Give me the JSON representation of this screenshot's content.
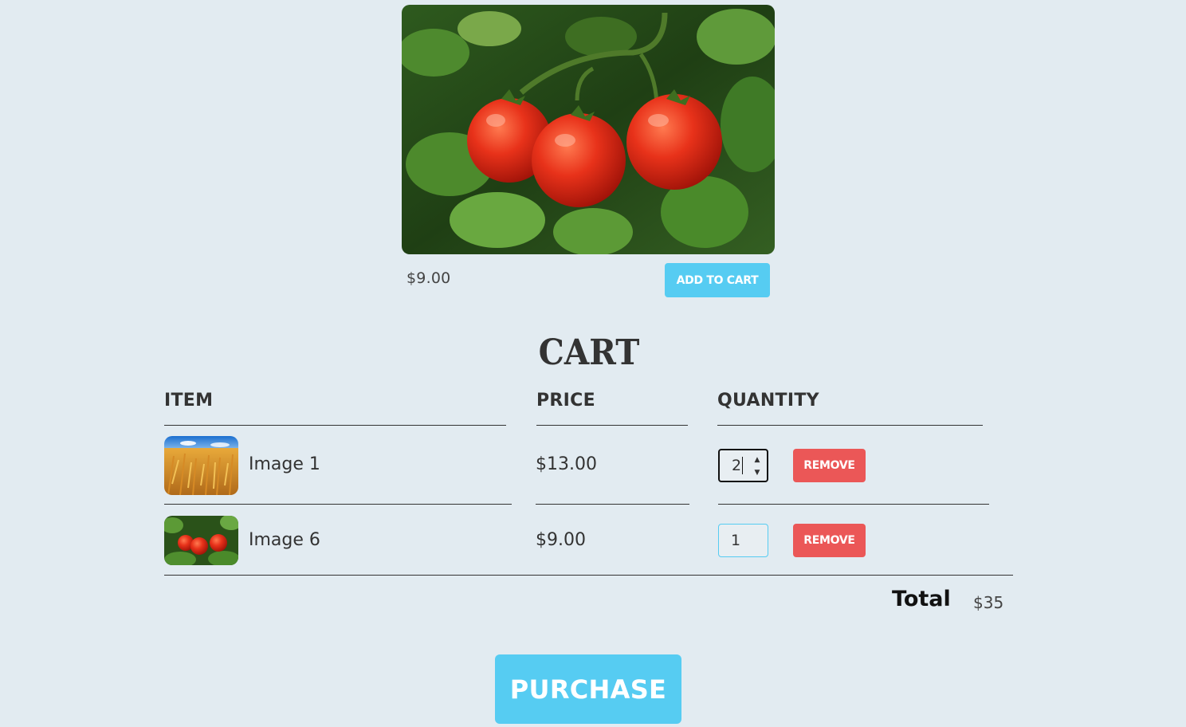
{
  "product": {
    "image_alt": "tomatoes",
    "price": "$9.00",
    "add_to_cart_label": "ADD TO CART"
  },
  "cart": {
    "title": "CART",
    "headers": {
      "item": "ITEM",
      "price": "PRICE",
      "quantity": "QUANTITY"
    },
    "rows": [
      {
        "thumbnail": "wheat-field",
        "name": "Image 1",
        "price": "$13.00",
        "quantity": "2",
        "remove_label": "REMOVE"
      },
      {
        "thumbnail": "tomatoes",
        "name": "Image 6",
        "price": "$9.00",
        "quantity": "1",
        "remove_label": "REMOVE"
      }
    ],
    "total_label": "Total",
    "total_value": "$35"
  },
  "purchase_label": "PURCHASE",
  "colors": {
    "background": "#e2ebf1",
    "primary": "#56ccf2",
    "danger": "#eb5757",
    "text": "#333333"
  }
}
